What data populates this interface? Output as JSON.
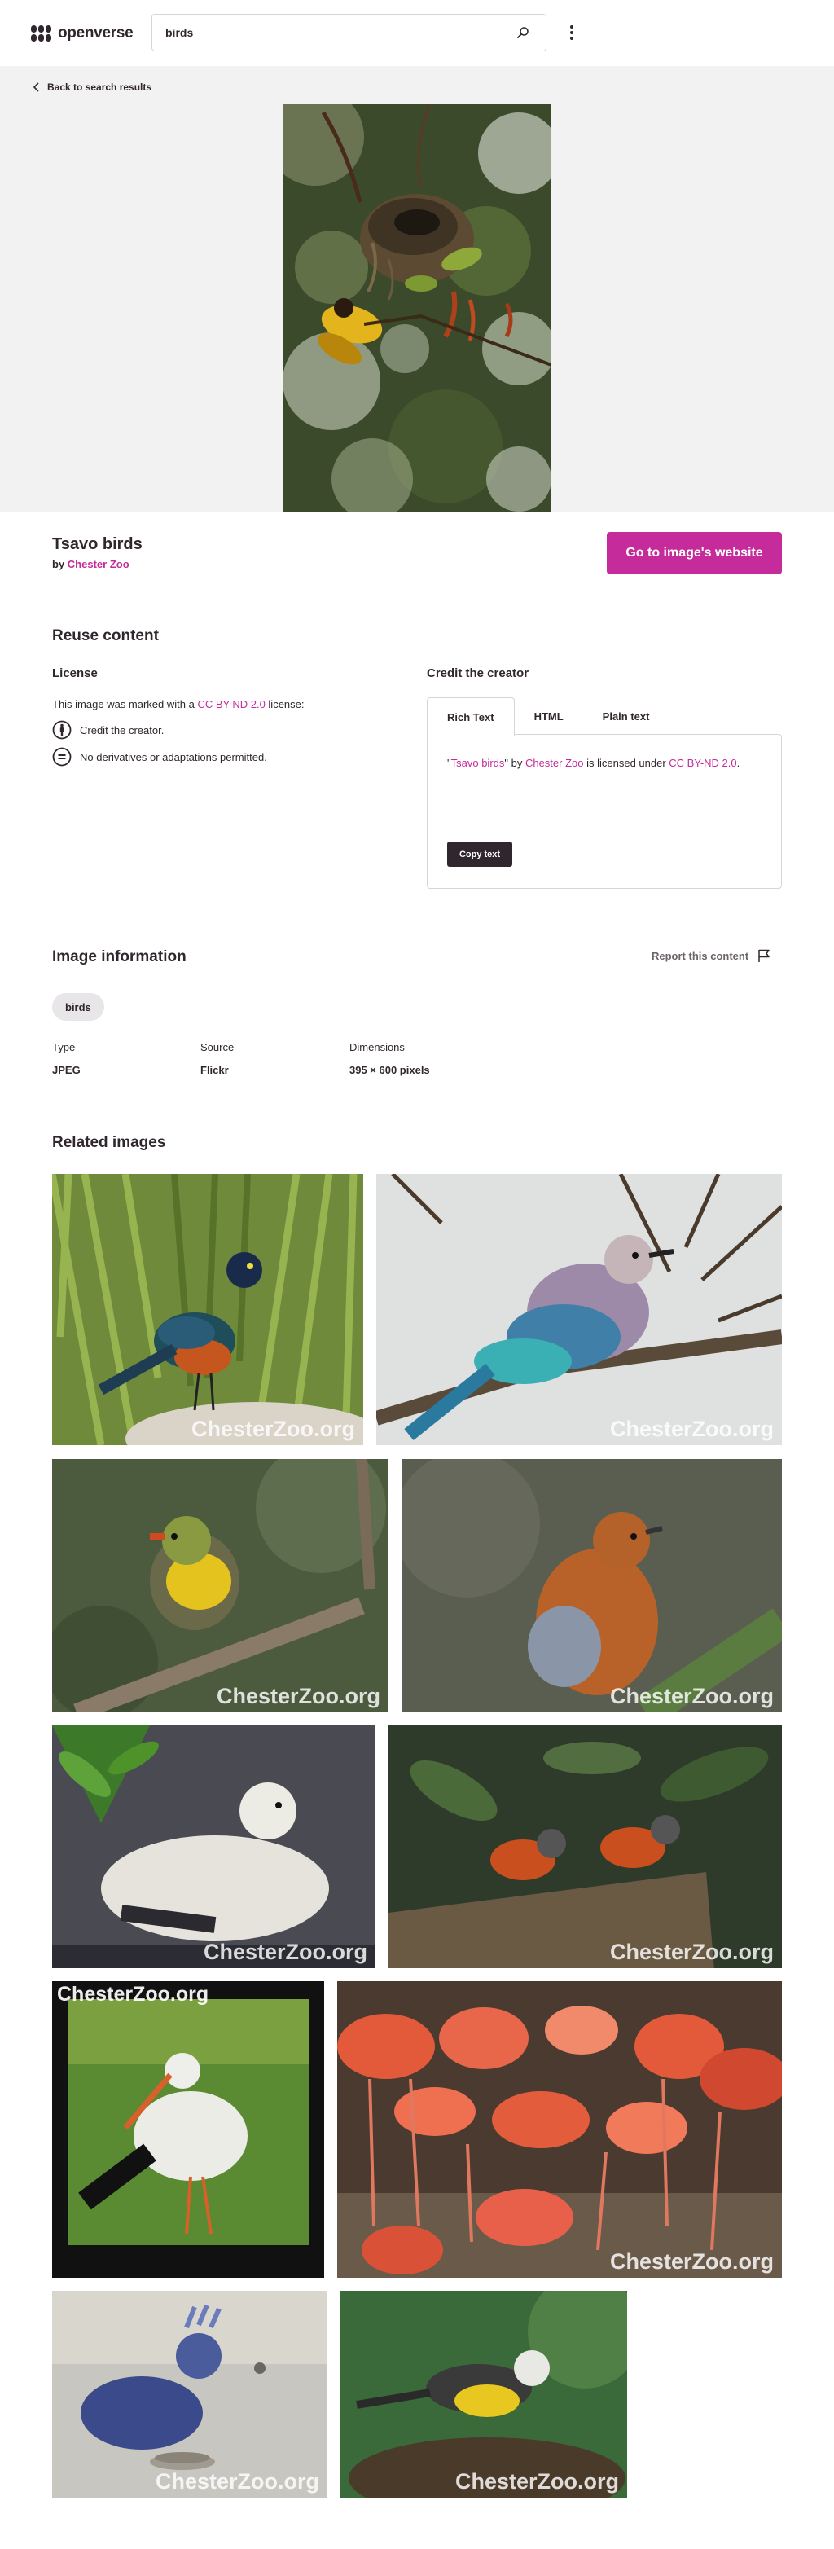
{
  "header": {
    "logo_text": "openverse",
    "search_value": "birds"
  },
  "hero": {
    "back_label": "Back to search results"
  },
  "image": {
    "title": "Tsavo birds",
    "by_prefix": "by",
    "creator": "Chester Zoo",
    "go_button": "Go to image's website"
  },
  "reuse": {
    "section_title": "Reuse content",
    "license_title": "License",
    "license_prefix": "This image was marked with a",
    "license_name": "CC BY-ND 2.0",
    "license_suffix": "license:",
    "conditions": [
      {
        "icon": "by-icon",
        "text": "Credit the creator."
      },
      {
        "icon": "nd-icon",
        "text": "No derivatives or adaptations permitted."
      }
    ],
    "credit_title": "Credit the creator",
    "tabs": [
      {
        "label": "Rich Text",
        "active": true
      },
      {
        "label": "HTML",
        "active": false
      },
      {
        "label": "Plain text",
        "active": false
      }
    ],
    "credit": {
      "quote_open": "\"",
      "title": "Tsavo birds",
      "quote_close": "\" by ",
      "creator": "Chester Zoo",
      "middle": " is licensed under ",
      "license": "CC BY-ND 2.0",
      "end": "."
    },
    "copy_button": "Copy text"
  },
  "info": {
    "section_title": "Image information",
    "report_label": "Report this content",
    "tag": "birds",
    "fields": [
      {
        "label": "Type",
        "value": "JPEG",
        "is_link": false
      },
      {
        "label": "Source",
        "value": "Flickr",
        "is_link": true
      },
      {
        "label": "Dimensions",
        "value": "395 × 600 pixels",
        "is_link": false
      }
    ]
  },
  "related": {
    "section_title": "Related images",
    "watermark": "ChesterZoo.org"
  },
  "colors": {
    "accent": "#c52b9b",
    "text": "#30272e",
    "hero_bg": "#f3f2f3"
  }
}
